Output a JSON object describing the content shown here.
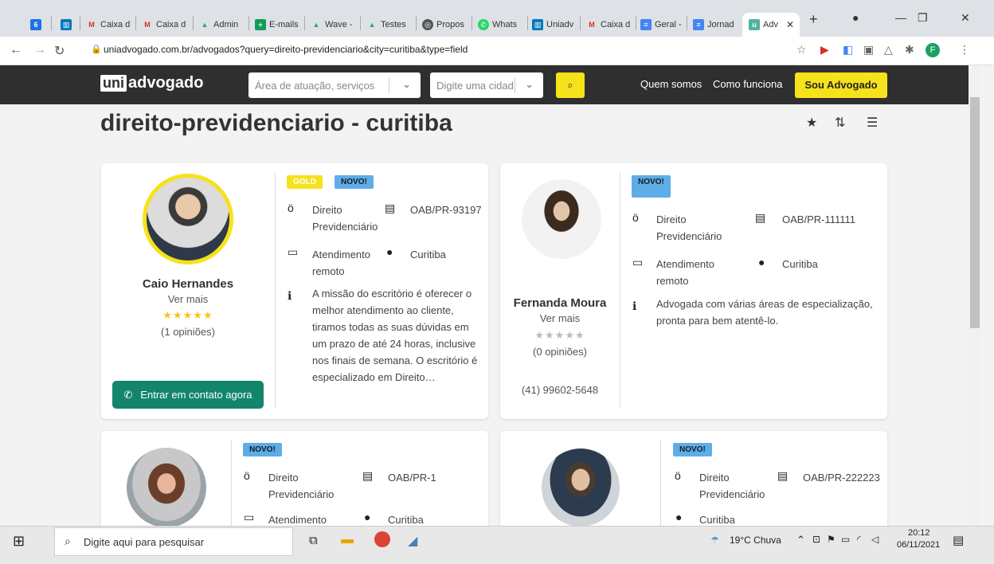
{
  "browser": {
    "tabs": [
      "Caixa d",
      "Caixa d",
      "Admin",
      "E-mails",
      "Wave -",
      "Testes",
      "Propos",
      "Whats",
      "Uniadv",
      "Caixa d",
      "Geral -",
      "Jornad",
      "Adv"
    ],
    "active_tab": "Adv",
    "url": "uniadvogado.com.br/advogados?query=direito-previdenciario&city=curitiba&type=field"
  },
  "site": {
    "logo_box": "uni",
    "logo_text": "advogado",
    "area_placeholder": "Área de atuação, serviços",
    "city_placeholder": "Digite uma cidad",
    "nav_quem_somos": "Quem somos",
    "nav_como_funciona": "Como funciona",
    "cta_label": "Sou Advogado"
  },
  "page": {
    "title": "direito-previdenciario - curitiba"
  },
  "lawyers": [
    {
      "name": "Caio Hernandes",
      "ver_mais": "Ver mais",
      "rating": 5,
      "opinions": "(1 opiniões)",
      "badges": [
        "GOLD",
        "NOVO!"
      ],
      "area_line1": "Direito",
      "area_line2": "Previdenciário",
      "oab": "OAB/PR-93197",
      "atendimento_line1": "Atendimento",
      "atendimento_line2": "remoto",
      "city": "Curitiba",
      "description": [
        "A missão do escritório é oferecer o",
        "melhor atendimento ao cliente,",
        "tiramos todas as suas dúvidas em",
        "um prazo de até 24 horas, inclusive",
        "nos finais de semana. O escritório é",
        "especializado em Direito…"
      ],
      "contact_button": "Entrar em contato agora"
    },
    {
      "name": "Fernanda Moura",
      "ver_mais": "Ver mais",
      "rating": 0,
      "opinions": "(0 opiniões)",
      "phone": "(41) 99602-5648",
      "badges": [
        "NOVO!"
      ],
      "area_line1": "Direito",
      "area_line2": "Previdenciário",
      "oab": "OAB/PR-111111",
      "atendimento_line1": "Atendimento",
      "atendimento_line2": "remoto",
      "city": "Curitiba",
      "description": [
        "Advogada com várias áreas de especialização,",
        "pronta para bem atentê-lo."
      ]
    },
    {
      "badges": [
        "NOVO!"
      ],
      "area_line1": "Direito",
      "area_line2": "Previdenciário",
      "oab": "OAB/PR-1",
      "atendimento_line1": "Atendimento",
      "city": "Curitiba"
    },
    {
      "badges": [
        "NOVO!"
      ],
      "area_line1": "Direito",
      "area_line2": "Previdenciário",
      "oab": "OAB/PR-222223",
      "city": "Curitiba"
    }
  ],
  "taskbar": {
    "search_placeholder": "Digite aqui para pesquisar",
    "weather": "19°C  Chuva",
    "time": "20:12",
    "date": "06/11/2021"
  },
  "colors": {
    "header_bg": "#2f2f2f",
    "accent_yellow": "#f5e21b",
    "badge_blue": "#5dade8",
    "whatsapp_green": "#13856b",
    "star_gold": "#f5c518",
    "star_gray": "#bbbbbb"
  }
}
